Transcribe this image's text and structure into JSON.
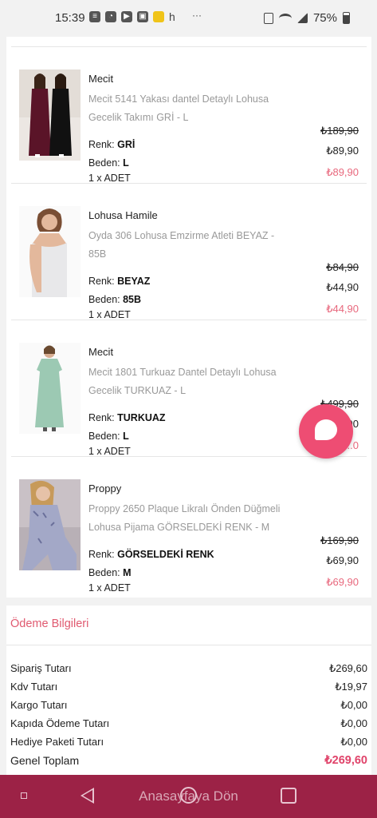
{
  "status_bar": {
    "time": "15:39",
    "extra": "h",
    "dots": "···",
    "battery": "75%"
  },
  "products": [
    {
      "brand": "Mecit",
      "name": "Mecit 5141 Yakası dantel Detaylı Lohusa Gecelik Takımı GRİ - L",
      "renk_label": "Renk: ",
      "renk_value": "GRİ",
      "beden_label": "Beden: ",
      "beden_value": "L",
      "qty": "1 x ADET",
      "old_price": "₺189,90",
      "price": "₺89,90",
      "line_total": "₺89,90",
      "image": "two-women-dark-nightgowns"
    },
    {
      "brand": "Lohusa Hamile",
      "name": "Oyda 306 Lohusa Emzirme Atleti BEYAZ - 85B",
      "renk_label": "Renk: ",
      "renk_value": "BEYAZ",
      "beden_label": "Beden: ",
      "beden_value": "85B",
      "qty": "1 x ADET",
      "old_price": "₺84,90",
      "price": "₺44,90",
      "line_total": "₺44,90",
      "image": "woman-white-nursing-top"
    },
    {
      "brand": "Mecit",
      "name": "Mecit 1801 Turkuaz Dantel Detaylı Lohusa Gecelik TURKUAZ - L",
      "renk_label": "Renk: ",
      "renk_value": "TURKUAZ",
      "beden_label": "Beden: ",
      "beden_value": "L",
      "qty": "1 x ADET",
      "old_price": "₺499,90",
      "price": "...90",
      "line_total": "...0",
      "image": "woman-turquoise-nightgown"
    },
    {
      "brand": "Proppy",
      "name": "Proppy 2650 Plaque Likralı Önden Düğmeli Lohusa Pijama GÖRSELDEKİ RENK - M",
      "renk_label": "Renk: ",
      "renk_value": "GÖRSELDEKİ RENK",
      "beden_label": "Beden: ",
      "beden_value": "M",
      "qty": "1 x ADET",
      "old_price": "₺169,90",
      "price": "₺69,90",
      "line_total": "₺69,90",
      "image": "woman-floral-pajamas"
    }
  ],
  "payment": {
    "title": "Ödeme Bilgileri",
    "rows": [
      {
        "label": "Sipariş Tutarı",
        "value": "₺269,60"
      },
      {
        "label": "Kdv Tutarı",
        "value": "₺19,97"
      },
      {
        "label": "Kargo Tutarı",
        "value": "₺0,00"
      },
      {
        "label": "Kapıda Ödeme Tutarı",
        "value": "₺0,00"
      },
      {
        "label": "Hediye Paketi Tutarı",
        "value": "₺0,00"
      }
    ],
    "total_label": "Genel Toplam",
    "total_value": "₺269,60"
  },
  "bottom_bar": {
    "label": "Anasayfaya Dön"
  },
  "colors": {
    "accent": "#e05a70",
    "bar": "#9c2246",
    "fab": "#ee4d73"
  }
}
